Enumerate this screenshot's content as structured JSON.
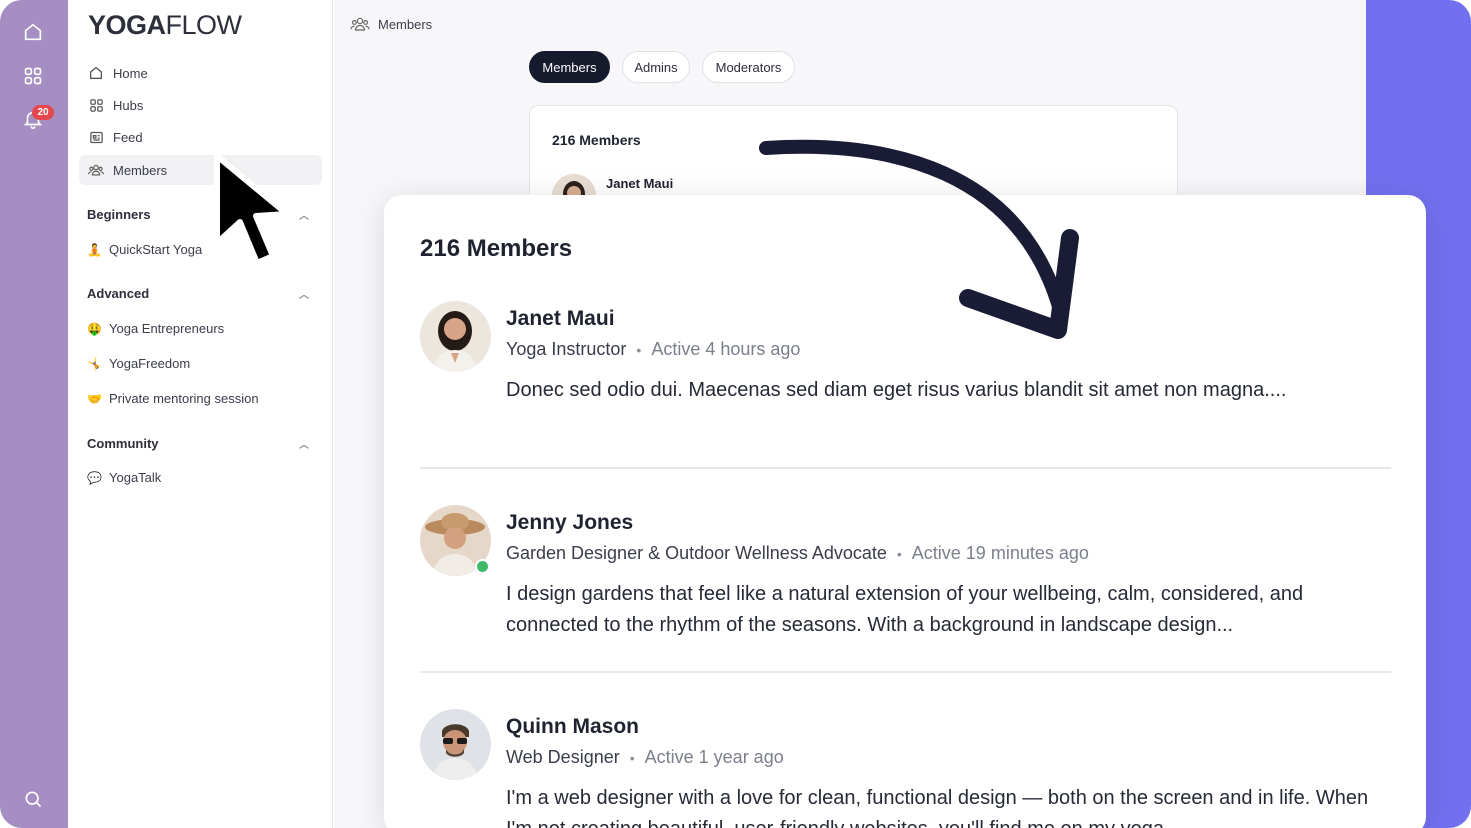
{
  "brand": {
    "bold": "YOGA",
    "light": "FLOW"
  },
  "rail": {
    "notification_count": "20"
  },
  "nav": [
    {
      "label": "Home",
      "icon": "home-icon"
    },
    {
      "label": "Hubs",
      "icon": "hubs-icon"
    },
    {
      "label": "Feed",
      "icon": "feed-icon"
    },
    {
      "label": "Members",
      "icon": "members-icon",
      "active": true
    }
  ],
  "sections": [
    {
      "title": "Beginners",
      "items": [
        {
          "emoji": "🧘",
          "label": "QuickStart Yoga"
        }
      ]
    },
    {
      "title": "Advanced",
      "items": [
        {
          "emoji": "🤑",
          "label": "Yoga Entrepreneurs"
        },
        {
          "emoji": "🤸",
          "label": "YogaFreedom"
        },
        {
          "emoji": "🤝",
          "label": "Private mentoring session"
        }
      ]
    },
    {
      "title": "Community",
      "items": [
        {
          "emoji": "💬",
          "label": "YogaTalk"
        }
      ]
    }
  ],
  "breadcrumb": "Members",
  "tabs": [
    {
      "label": "Members",
      "active": true
    },
    {
      "label": "Admins"
    },
    {
      "label": "Moderators"
    }
  ],
  "background_card": {
    "count": "216 Members",
    "first_member": "Janet Maui"
  },
  "zoom": {
    "count": "216 Members",
    "members": [
      {
        "name": "Janet Maui",
        "role": "Yoga Instructor",
        "active": "Active 4 hours ago",
        "bio": "Donec sed odio dui. Maecenas sed diam eget risus varius blandit sit amet non magna....",
        "online": false
      },
      {
        "name": "Jenny Jones",
        "role": "Garden Designer & Outdoor Wellness Advocate",
        "active": "Active 19 minutes ago",
        "bio": "I design gardens that feel like a natural extension of your wellbeing, calm, considered, and connected to the rhythm of the seasons. With a background in landscape design...",
        "online": true
      },
      {
        "name": "Quinn Mason",
        "role": "Web Designer",
        "active": "Active 1 year ago",
        "bio": "I'm a web designer with a love for clean, functional design — both on the screen and in life. When I'm not creating beautiful, user-friendly websites, you'll find me on my yoga",
        "online": false
      }
    ]
  },
  "colors": {
    "rail": "#a48ec2",
    "accent_bg": "#7370f0",
    "active_tab": "#151a2d",
    "online": "#3fb96a",
    "badge": "#e5484d"
  }
}
